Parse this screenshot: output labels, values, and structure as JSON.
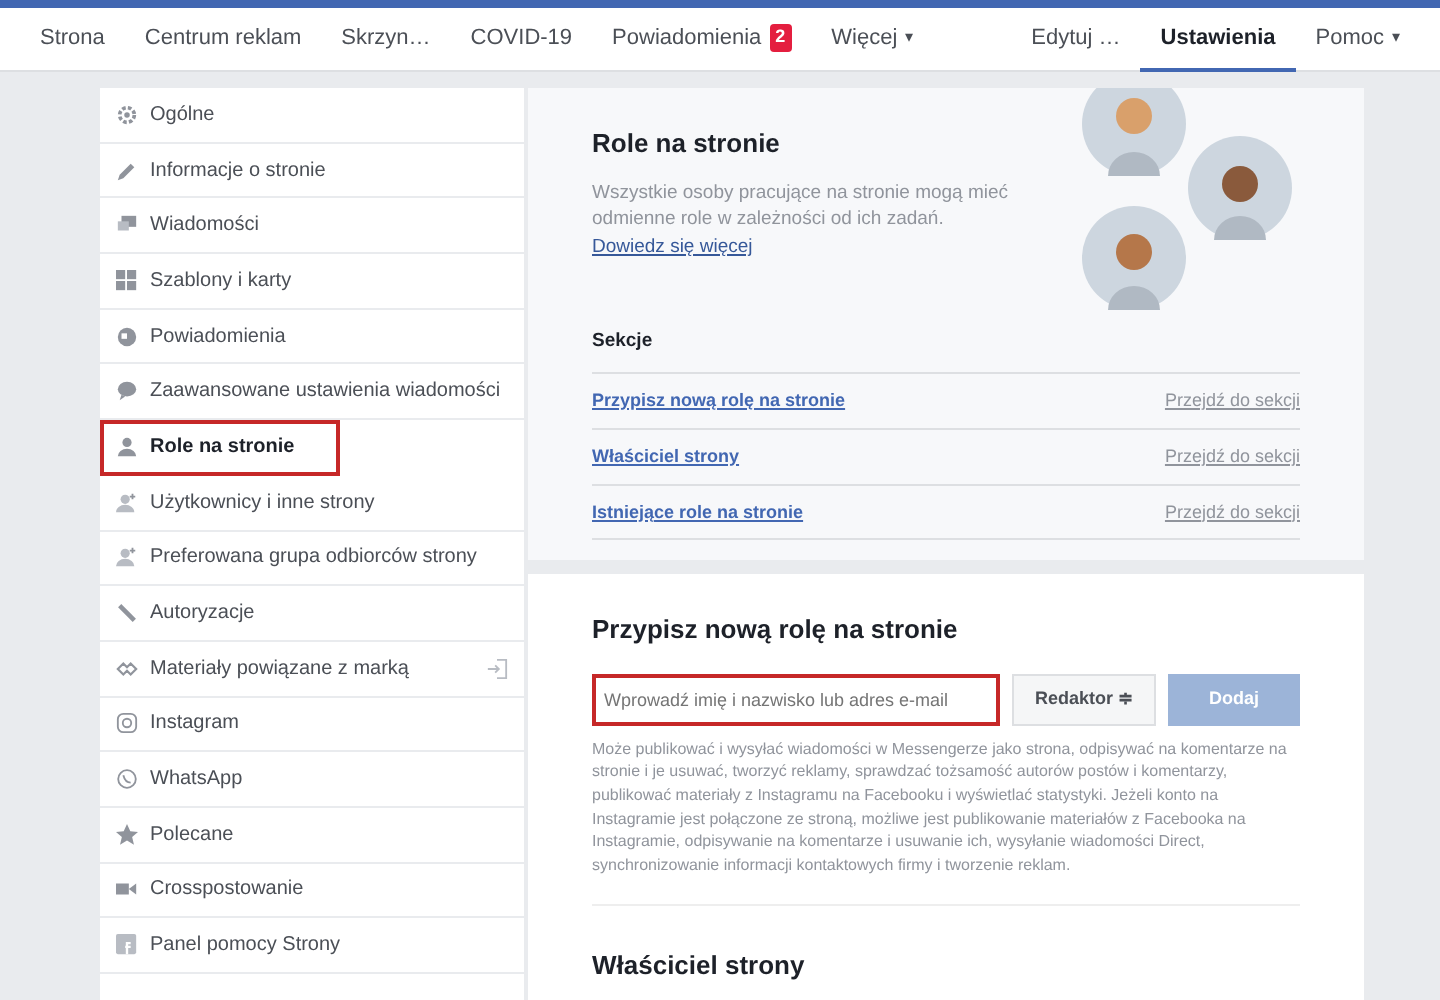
{
  "top_nav": {
    "left": [
      {
        "label": "Strona",
        "selected": false
      },
      {
        "label": "Centrum reklam",
        "selected": false
      },
      {
        "label": "Skrzyn…",
        "selected": false
      },
      {
        "label": "COVID-19",
        "selected": false
      },
      {
        "label": "Powiadomienia",
        "selected": false,
        "badge": "2"
      },
      {
        "label": "Więcej",
        "selected": false,
        "caret": "▾"
      }
    ],
    "right": [
      {
        "label": "Edytuj …",
        "selected": false
      },
      {
        "label": "Ustawienia",
        "selected": true
      },
      {
        "label": "Pomoc",
        "selected": false,
        "caret": "▾"
      }
    ]
  },
  "sidebar": {
    "items": [
      {
        "label": "Ogólne",
        "selected": false
      },
      {
        "label": "Informacje o stronie",
        "selected": false
      },
      {
        "label": "Wiadomości",
        "selected": false
      },
      {
        "label": "Szablony i karty",
        "selected": false
      },
      {
        "label": "Powiadomienia",
        "selected": false
      },
      {
        "label": "Zaawansowane ustawienia wiadomości",
        "selected": false
      },
      {
        "label": "Role na stronie",
        "selected": true
      },
      {
        "label": "Użytkownicy i inne strony",
        "selected": false
      },
      {
        "label": "Preferowana grupa odbiorców strony",
        "selected": false
      },
      {
        "label": "Autoryzacje",
        "selected": false
      },
      {
        "label": "Materiały powiązane z marką",
        "selected": false
      },
      {
        "label": "Instagram",
        "selected": false
      },
      {
        "label": "WhatsApp",
        "selected": false
      },
      {
        "label": "Polecane",
        "selected": false
      },
      {
        "label": "Crosspostowanie",
        "selected": false
      },
      {
        "label": "Panel pomocy Strony",
        "selected": false
      }
    ]
  },
  "roles": {
    "title": "Role na stronie",
    "description": "Wszystkie osoby pracujące na stronie mogą mieć odmienne role w zależności od ich zadań.",
    "learn_more": "Dowiedz się więcej",
    "sections_heading": "Sekcje",
    "sections": [
      {
        "name": "Przypisz nową rolę na stronie",
        "action": "Przejdź do sekcji"
      },
      {
        "name": "Właściciel strony",
        "action": "Przejdź do sekcji"
      },
      {
        "name": "Istniejące role na stronie",
        "action": "Przejdź do sekcji"
      }
    ]
  },
  "assign": {
    "title": "Przypisz nową rolę na stronie",
    "placeholder": "Wprowadź imię i nazwisko lub adres e-mail",
    "highlighted": true,
    "role": "Redaktor ≑",
    "add_button": "Dodaj",
    "add_disabled": true,
    "help": "Może publikować i wysyłać wiadomości w Messengerze jako strona, odpisywać na komentarze na stronie i je usuwać, tworzyć reklamy, sprawdzać tożsamość autorów postów i komentarzy, publikować materiały z Instagramu na Facebooku i wyświetlać statystyki. Jeżeli konto na Instagramie jest połączone ze stroną, możliwe jest publikowanie materiałów z Facebooka na Instagramie, odpisywanie na komentarze i usuwanie ich, wysyłanie wiadomości Direct, synchronizowanie informacji kontaktowych firmy i tworzenie reklam."
  },
  "owner": {
    "title": "Właściciel strony"
  }
}
